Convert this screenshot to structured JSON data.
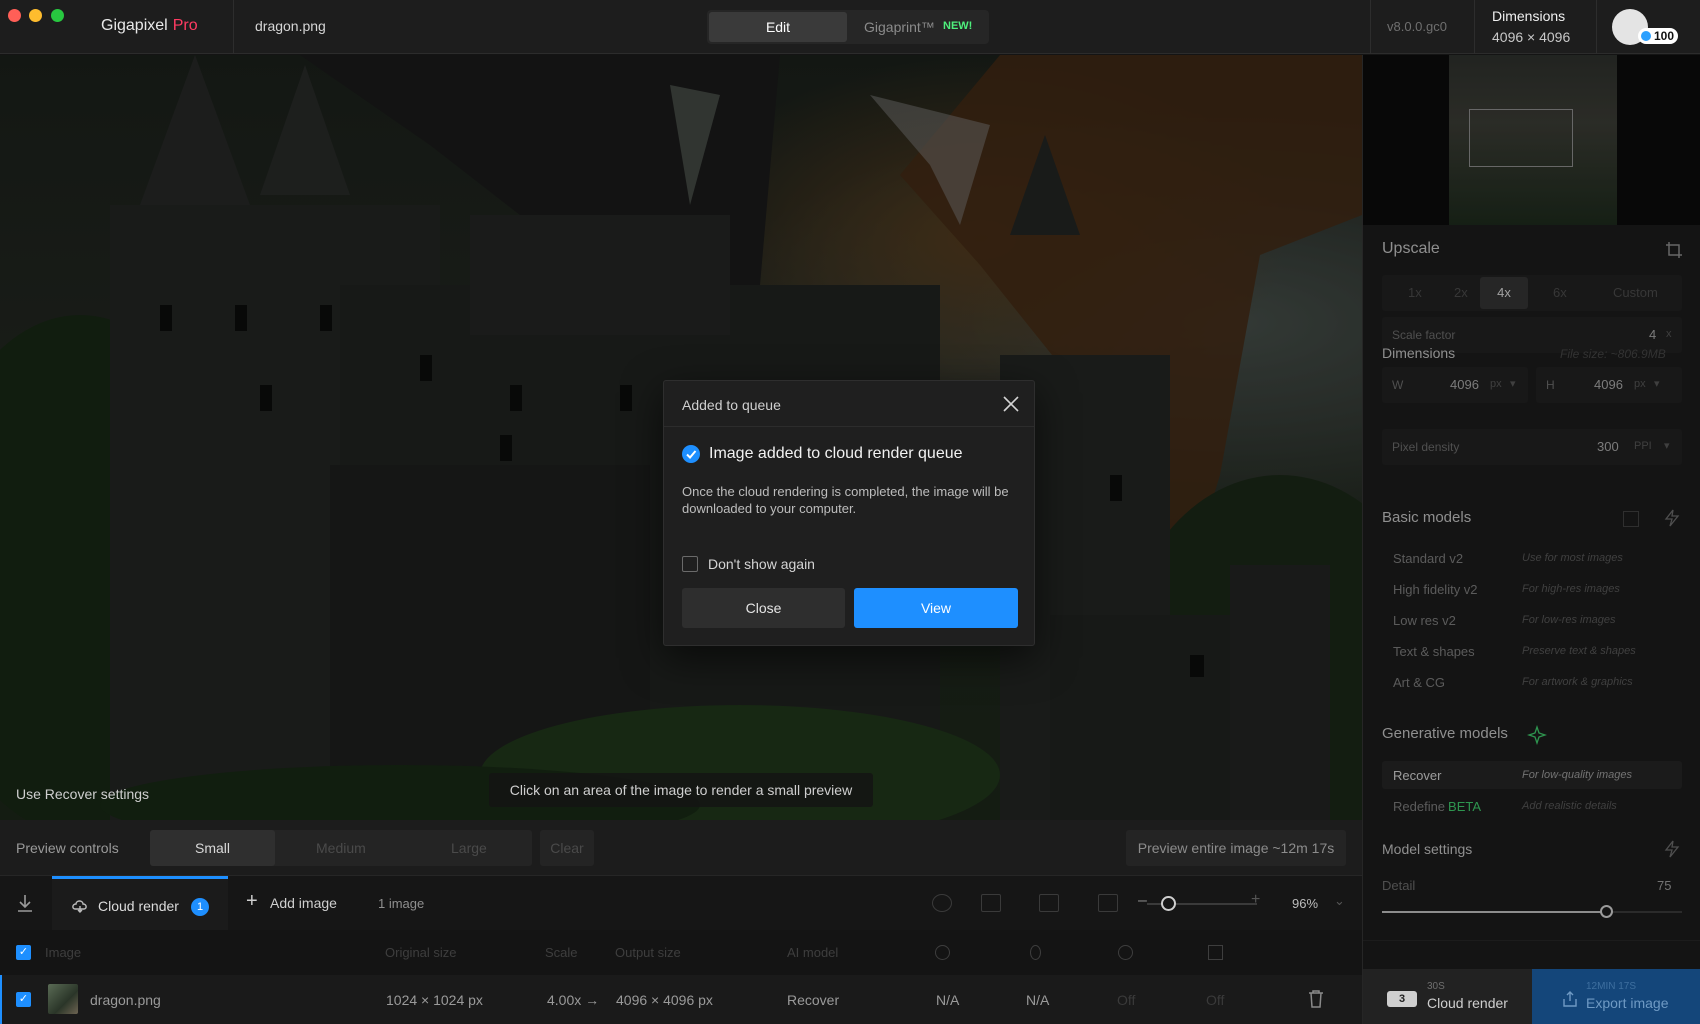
{
  "titlebar": {
    "app_name": "Gigapixel",
    "app_tier": "Pro",
    "file_name": "dragon.png",
    "mode_edit": "Edit",
    "mode_gigaprint": "Gigaprint™",
    "mode_new_badge": "NEW!",
    "version": "v8.0.0.gc0",
    "dimensions_label": "Dimensions",
    "dimensions_value": "4096 × 4096",
    "credits": "100"
  },
  "canvas": {
    "recover_note": "Use Recover settings",
    "preview_hint": "Click on an area of the image to render a small preview"
  },
  "preview_controls": {
    "label": "Preview controls",
    "small": "Small",
    "medium": "Medium",
    "large": "Large",
    "clear": "Clear",
    "entire": "Preview entire image ~12m 17s"
  },
  "queue_bar": {
    "cloud_render": "Cloud render",
    "cloud_badge": "1",
    "add_image": "Add image",
    "image_count": "1 image",
    "zoom": "96%"
  },
  "table": {
    "headers": {
      "image": "Image",
      "original_size": "Original size",
      "scale": "Scale",
      "output_size": "Output size",
      "ai_model": "AI model"
    },
    "rows": [
      {
        "name": "dragon.png",
        "original_size": "1024 × 1024 px",
        "scale": "4.00x →",
        "output_size": "4096 × 4096 px",
        "ai_model": "Recover",
        "c1": "N/A",
        "c2": "N/A",
        "c3": "Off",
        "c4": "Off"
      }
    ]
  },
  "right_panel": {
    "upscale_title": "Upscale",
    "scales": [
      "1x",
      "2x",
      "4x",
      "6x",
      "Custom"
    ],
    "scale_factor_label": "Scale factor",
    "scale_factor_value": "4",
    "scale_factor_unit": "x",
    "dimensions_title": "Dimensions",
    "file_size": "File size: ~806.9MB",
    "w_label": "W",
    "w_value": "4096",
    "w_unit": "px",
    "h_label": "H",
    "h_value": "4096",
    "h_unit": "px",
    "pixel_density_label": "Pixel density",
    "pixel_density_value": "300",
    "pixel_density_unit": "PPI",
    "basic_models_title": "Basic models",
    "basic_models": [
      {
        "name": "Standard v2",
        "desc": "Use for most images"
      },
      {
        "name": "High fidelity v2",
        "desc": "For high-res images"
      },
      {
        "name": "Low res v2",
        "desc": "For low-res images"
      },
      {
        "name": "Text & shapes",
        "desc": "Preserve text & shapes"
      },
      {
        "name": "Art & CG",
        "desc": "For artwork & graphics"
      }
    ],
    "generative_models_title": "Generative models",
    "generative_models": [
      {
        "name": "Recover",
        "desc": "For low-quality images"
      },
      {
        "name": "Redefine",
        "beta": "BETA",
        "desc": "Add realistic details"
      }
    ],
    "model_settings_title": "Model settings",
    "detail_label": "Detail",
    "detail_value": "75",
    "detail_level": 75,
    "cloud_time": "30S",
    "cloud_label": "Cloud render",
    "cloud_credits": "3",
    "export_time": "12MIN 17S",
    "export_label": "Export image"
  },
  "modal": {
    "title": "Added to queue",
    "heading": "Image added to cloud render queue",
    "body": "Once the cloud rendering is completed, the image will be downloaded to your computer.",
    "checkbox_label": "Don't show again",
    "close_label": "Close",
    "view_label": "View"
  },
  "colors": {
    "accent": "#1e8fff",
    "pro": "#ff3b62",
    "new_badge": "#4ef07c",
    "beta": "#3ec76a"
  }
}
